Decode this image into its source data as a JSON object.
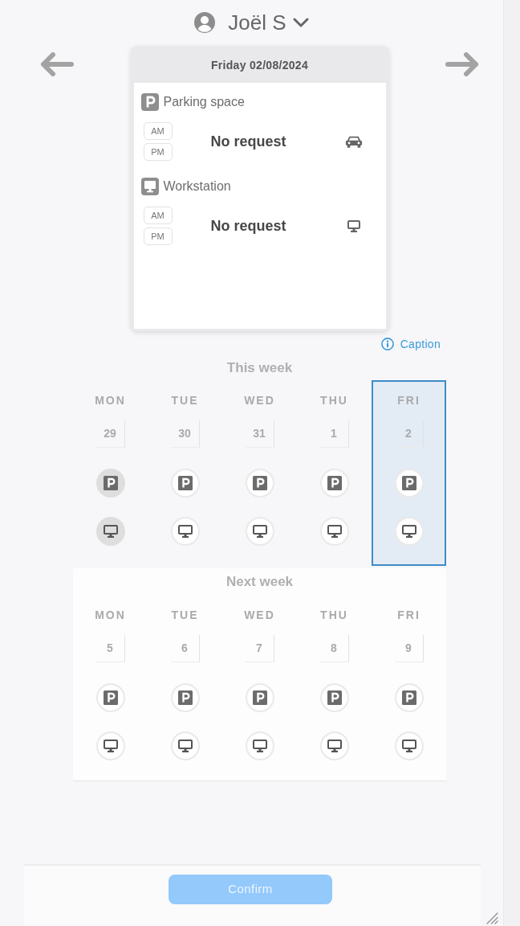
{
  "user": {
    "name": "Joël S"
  },
  "day_card": {
    "title": "Friday 02/08/2024",
    "sections": [
      {
        "kind": "parking",
        "label": "Parking space",
        "slots": [
          "AM",
          "PM"
        ],
        "status": "No request"
      },
      {
        "kind": "workstation",
        "label": "Workstation",
        "slots": [
          "AM",
          "PM"
        ],
        "status": "No request"
      }
    ]
  },
  "caption_link": "Caption",
  "weeks": [
    {
      "title": "This week",
      "days": [
        {
          "label": "MON",
          "date": "29",
          "selected": false,
          "bookings": [
            {
              "kind": "parking",
              "filled": true
            },
            {
              "kind": "workstation",
              "filled": true
            }
          ]
        },
        {
          "label": "TUE",
          "date": "30",
          "selected": false,
          "bookings": [
            {
              "kind": "parking",
              "filled": false
            },
            {
              "kind": "workstation",
              "filled": false
            }
          ]
        },
        {
          "label": "WED",
          "date": "31",
          "selected": false,
          "bookings": [
            {
              "kind": "parking",
              "filled": false
            },
            {
              "kind": "workstation",
              "filled": false
            }
          ]
        },
        {
          "label": "THU",
          "date": "1",
          "selected": false,
          "bookings": [
            {
              "kind": "parking",
              "filled": false
            },
            {
              "kind": "workstation",
              "filled": false
            }
          ]
        },
        {
          "label": "FRI",
          "date": "2",
          "selected": true,
          "bookings": [
            {
              "kind": "parking",
              "filled": false
            },
            {
              "kind": "workstation",
              "filled": false
            }
          ]
        }
      ]
    },
    {
      "title": "Next week",
      "days": [
        {
          "label": "MON",
          "date": "5",
          "selected": false,
          "bookings": [
            {
              "kind": "parking",
              "filled": false
            },
            {
              "kind": "workstation",
              "filled": false
            }
          ]
        },
        {
          "label": "TUE",
          "date": "6",
          "selected": false,
          "bookings": [
            {
              "kind": "parking",
              "filled": false
            },
            {
              "kind": "workstation",
              "filled": false
            }
          ]
        },
        {
          "label": "WED",
          "date": "7",
          "selected": false,
          "bookings": [
            {
              "kind": "parking",
              "filled": false
            },
            {
              "kind": "workstation",
              "filled": false
            }
          ]
        },
        {
          "label": "THU",
          "date": "8",
          "selected": false,
          "bookings": [
            {
              "kind": "parking",
              "filled": false
            },
            {
              "kind": "workstation",
              "filled": false
            }
          ]
        },
        {
          "label": "FRI",
          "date": "9",
          "selected": false,
          "bookings": [
            {
              "kind": "parking",
              "filled": false
            },
            {
              "kind": "workstation",
              "filled": false
            }
          ]
        }
      ]
    }
  ],
  "confirm": {
    "label": "Confirm",
    "disabled": true
  }
}
